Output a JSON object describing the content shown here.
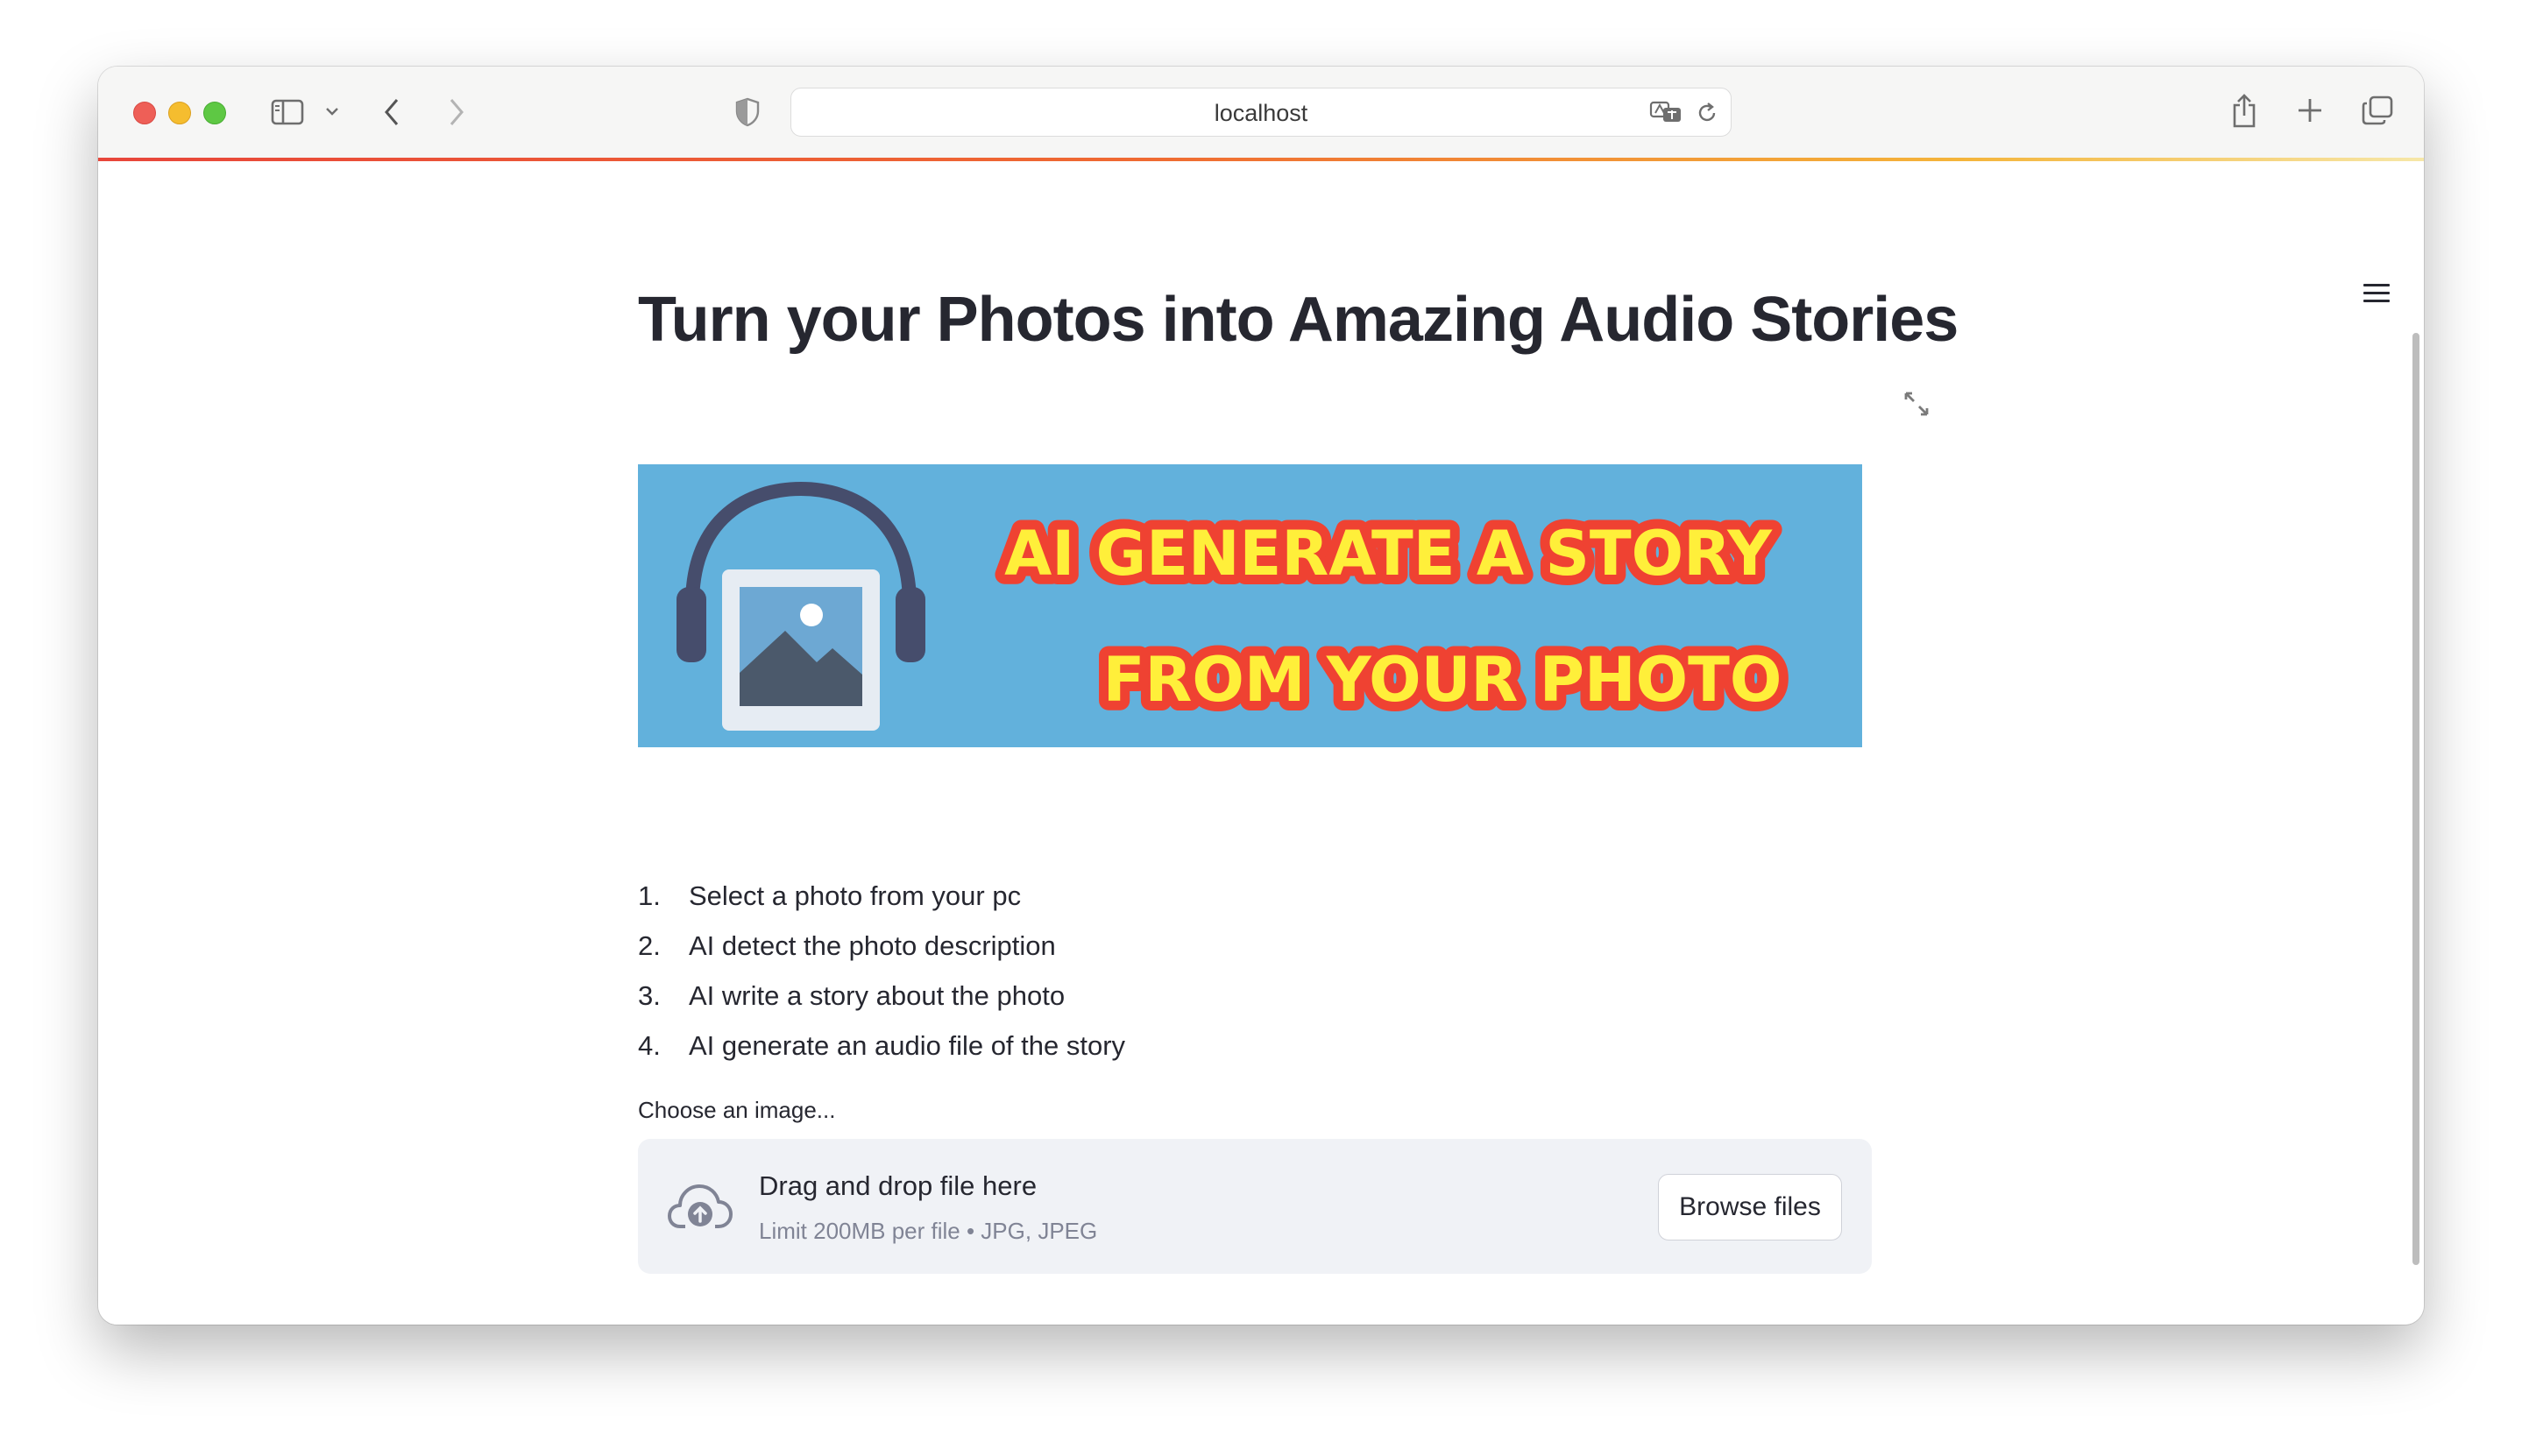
{
  "browser": {
    "url": "localhost",
    "icons": [
      "sidebar-icon",
      "chevron-down-icon",
      "back-icon",
      "forward-icon",
      "shield-icon",
      "translate-icon",
      "reload-icon",
      "share-icon",
      "new-tab-icon",
      "tabs-overview-icon"
    ]
  },
  "page": {
    "title": "Turn your Photos into Amazing Audio Stories",
    "banner": {
      "line1": "AI GENERATE  A STORY",
      "line2": "FROM YOUR PHOTO",
      "background": "#62b1dc",
      "text_color": "#ffef3a",
      "outline_color": "#e8392a"
    },
    "steps": [
      {
        "num": "1.",
        "text": "Select a photo from your pc"
      },
      {
        "num": "2.",
        "text": "AI detect the photo description"
      },
      {
        "num": "3.",
        "text": "AI write a story about the photo"
      },
      {
        "num": "4.",
        "text": "AI generate an audio file of the story"
      }
    ],
    "uploader": {
      "label": "Choose an image...",
      "title": "Drag and drop file here",
      "limit": "Limit 200MB per file • JPG, JPEG",
      "button": "Browse files"
    }
  }
}
